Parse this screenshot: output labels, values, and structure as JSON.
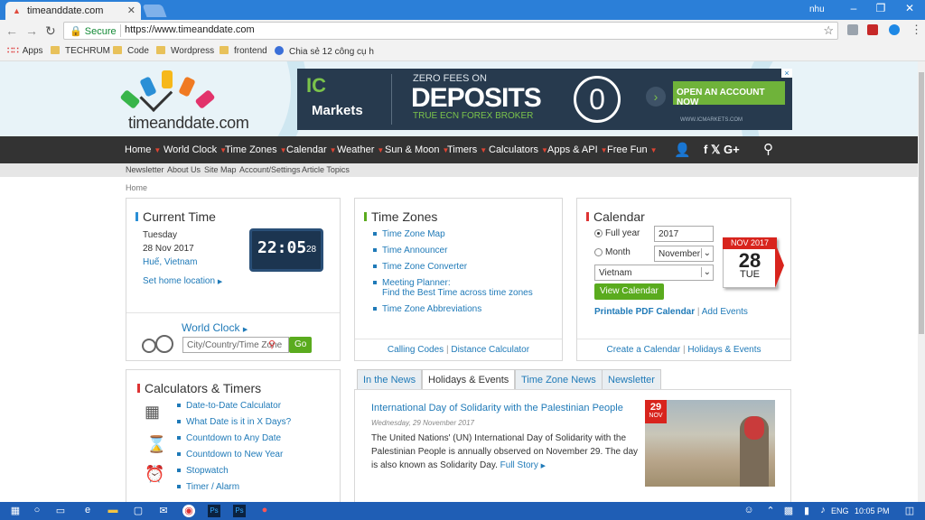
{
  "browser": {
    "tab_title": "timeanddate.com",
    "user": "nhu",
    "secure_label": "Secure",
    "url": "https://www.timeanddate.com",
    "bookmarks": [
      "Apps",
      "TECHRUM",
      "Code",
      "Wordpress",
      "frontend",
      "Chia sẻ 12 công cụ h"
    ]
  },
  "header": {
    "logo_text": "timeanddate.com",
    "ad": {
      "brand_top": "IC",
      "brand_bottom": "Markets",
      "line1": "ZERO FEES ON",
      "line2": "DEPOSITS",
      "line3": "TRUE ECN FOREX BROKER",
      "cta": "OPEN AN ACCOUNT NOW",
      "url": "WWW.ICMARKETS.COM"
    }
  },
  "nav": [
    "Home",
    "World Clock",
    "Time Zones",
    "Calendar",
    "Weather",
    "Sun & Moon",
    "Timers",
    "Calculators",
    "Apps & API",
    "Free Fun"
  ],
  "subnav": [
    "Newsletter",
    "About Us",
    "Site Map",
    "Account/Settings",
    "Article Topics"
  ],
  "breadcrumb": "Home",
  "current_time": {
    "title": "Current Time",
    "day": "Tuesday",
    "date": "28 Nov 2017",
    "location": "Huế, Vietnam",
    "set_home": "Set home location",
    "clock": "22:05",
    "seconds": "28",
    "world_clock": "World Clock",
    "search_placeholder": "City/Country/Time Zone",
    "go": "Go"
  },
  "time_zones": {
    "title": "Time Zones",
    "items": [
      "Time Zone Map",
      "Time Announcer",
      "Time Zone Converter",
      "Meeting Planner:",
      "Time Zone Abbreviations"
    ],
    "meeting_sub": "Find the Best Time across time zones",
    "footer_left": "Calling Codes",
    "footer_right": "Distance Calculator"
  },
  "calendar": {
    "title": "Calendar",
    "full_year": "Full year",
    "year_value": "2017",
    "month": "Month",
    "month_value": "November",
    "country": "Vietnam",
    "button": "View Calendar",
    "pdf": "Printable PDF Calendar",
    "add_events": "Add Events",
    "icon_month": "NOV 2017",
    "icon_day": "28",
    "icon_weekday": "TUE",
    "footer_left": "Create a Calendar",
    "footer_right": "Holidays & Events"
  },
  "calculators": {
    "title": "Calculators & Timers",
    "items": [
      "Date-to-Date Calculator",
      "What Date is it in X Days?",
      "Countdown to Any Date",
      "Countdown to New Year",
      "Stopwatch",
      "Timer / Alarm"
    ]
  },
  "news": {
    "tabs": [
      "In the News",
      "Holidays & Events",
      "Time Zone News",
      "Newsletter"
    ],
    "headline": "International Day of Solidarity with the Palestinian People",
    "date": "Wednesday, 29 November 2017",
    "body": "The United Nations' (UN) International Day of Solidarity with the Palestinian People is annually observed on November 29. The day is also known as Solidarity Day.",
    "more": "Full Story",
    "badge_day": "29",
    "badge_month": "NOV"
  },
  "taskbar": {
    "lang": "ENG",
    "time": "10:05 PM"
  },
  "colors": {
    "nav_bg": "#333333",
    "link": "#1f7ab8",
    "green": "#5aab1e",
    "taskbar": "#1f5eb5"
  }
}
